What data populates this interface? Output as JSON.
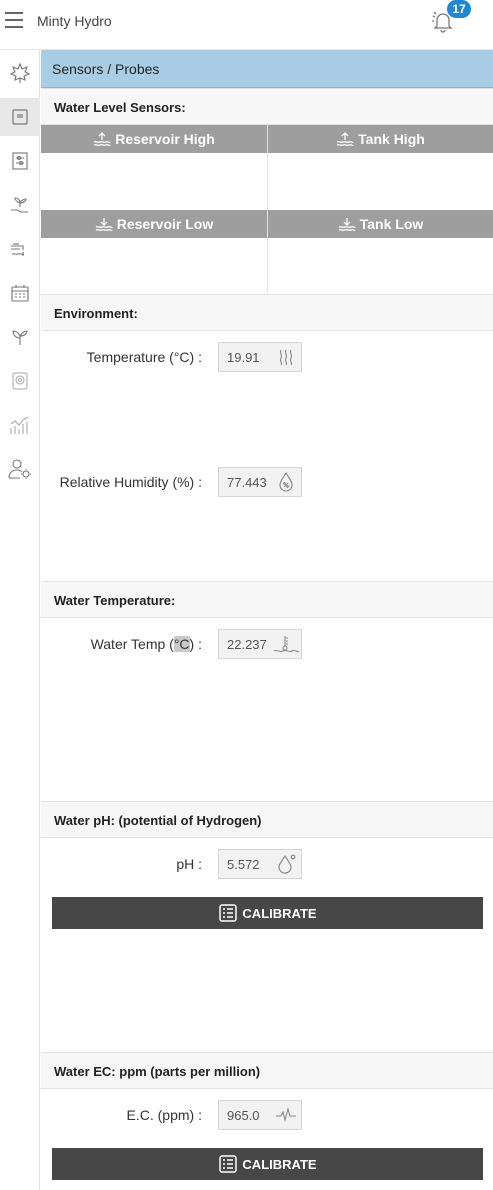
{
  "header": {
    "title": "Minty Hydro",
    "notification_count": "17"
  },
  "sidebar": {
    "items": [
      {
        "icon": "leaf-icon"
      },
      {
        "icon": "sensor-panel-icon",
        "active": true
      },
      {
        "icon": "controls-icon"
      },
      {
        "icon": "seedling-hand-icon"
      },
      {
        "icon": "water-tap-icon"
      },
      {
        "icon": "calendar-icon"
      },
      {
        "icon": "plant-icon"
      },
      {
        "icon": "camera-icon"
      },
      {
        "icon": "chart-icon"
      },
      {
        "icon": "user-settings-icon"
      }
    ]
  },
  "panel": {
    "title": "Sensors / Probes"
  },
  "water_level": {
    "title": "Water Level Sensors:",
    "sensors": [
      {
        "label": "Reservoir High",
        "icon": "water-level-up-icon"
      },
      {
        "label": "Tank High",
        "icon": "water-level-up-icon"
      },
      {
        "label": "Reservoir Low",
        "icon": "water-level-down-icon"
      },
      {
        "label": "Tank Low",
        "icon": "water-level-down-icon"
      }
    ]
  },
  "environment": {
    "title": "Environment:",
    "temperature": {
      "label_a": "Temperature (",
      "label_unit": "°C",
      "label_b": ") :",
      "value": "19.91",
      "icon": "heat-waves-icon"
    },
    "humidity": {
      "label": "Relative Humidity (%) :",
      "value": "77.443",
      "icon": "humidity-drop-icon"
    }
  },
  "water_temp": {
    "title": "Water Temperature:",
    "field": {
      "label_a": "Water Temp (",
      "label_unit": "°C",
      "label_b": ") :",
      "value": "22.237",
      "icon": "water-thermometer-icon"
    }
  },
  "ph": {
    "title": "Water pH: (potential of Hydrogen)",
    "field": {
      "label": "pH :",
      "value": "5.572",
      "icon": "drop-degree-icon"
    },
    "calibrate_label": "CALIBRATE"
  },
  "ec": {
    "title": "Water EC: ppm (parts per million)",
    "field": {
      "label": "E.C. (ppm) :",
      "value": "965.0",
      "icon": "pulse-icon"
    },
    "calibrate_label": "CALIBRATE"
  },
  "colors": {
    "header_blue": "#a9cde6",
    "badge_blue": "#1e88d6",
    "sensor_head_grey": "#9e9e9e",
    "button_dark": "#474747"
  }
}
